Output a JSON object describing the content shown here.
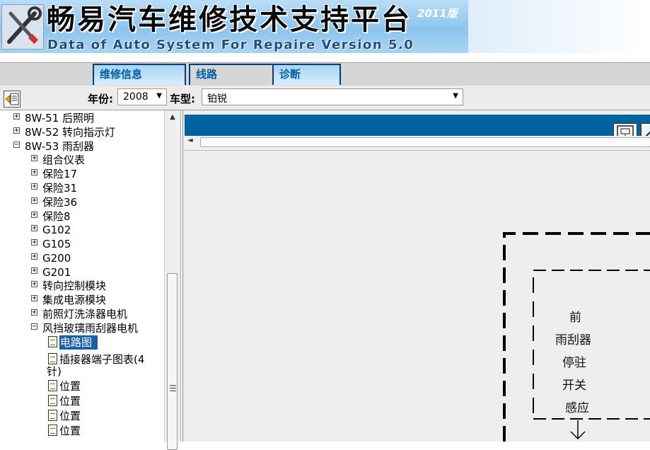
{
  "banner": {
    "title": "畅易汽车维修技术支持平台",
    "badge": "2011版",
    "subtitle": "Data of Auto System For Repaire Version 5.0"
  },
  "tabs": [
    {
      "label": "维修信息"
    },
    {
      "label": "线路"
    },
    {
      "label": "诊断"
    }
  ],
  "toolbar": {
    "year_label": "年份:",
    "year_value": "2008",
    "model_label": "车型:",
    "model_value": "铂锐"
  },
  "tree": {
    "expand_glyph": "+",
    "collapse_glyph": "−",
    "level1": [
      "8W-51 后照明",
      "8W-52 转向指示灯",
      "8W-53 雨刮器"
    ],
    "level2": [
      "组合仪表",
      "保险17",
      "保险31",
      "保险36",
      "保险8",
      "G102",
      "G105",
      "G200",
      "G201",
      "转向控制模块",
      "集成电源模块",
      "前照灯洗涤器电机",
      "风挡玻璃雨刮器电机"
    ],
    "leaves": [
      "电路图",
      "插接器端子图表(4",
      "针)",
      "位置",
      "位置",
      "位置",
      "位置"
    ]
  },
  "diagram": {
    "labels": [
      "前",
      "雨刮器",
      "停驻",
      "开关",
      "感应"
    ]
  },
  "icons": {
    "logo": "tools-icon",
    "toolbar": "back-arrow-icon",
    "header_btn_1": "window-icon",
    "header_btn_2": "expand-icon"
  },
  "colors": {
    "tab_border": "#003d7a",
    "diagram_header": "#00639e",
    "selected": "#1a5fa8"
  }
}
